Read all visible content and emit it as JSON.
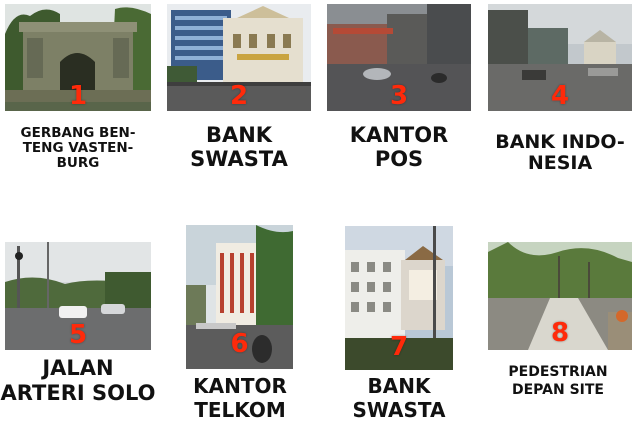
{
  "items": [
    {
      "number": "1",
      "caption": [
        "GERBANG BEN-",
        "TENG VASTEN-",
        "BURG"
      ]
    },
    {
      "number": "2",
      "caption": [
        "BANK",
        "SWASTA"
      ]
    },
    {
      "number": "3",
      "caption": [
        "KANTOR",
        "POS"
      ]
    },
    {
      "number": "4",
      "caption": [
        "BANK INDO-",
        "NESIA"
      ]
    },
    {
      "number": "5",
      "caption": [
        "JALAN",
        "ARTERI SOLO"
      ]
    },
    {
      "number": "6",
      "caption": [
        "KANTOR",
        "TELKOM"
      ]
    },
    {
      "number": "7",
      "caption": [
        "BANK",
        "SWASTA"
      ]
    },
    {
      "number": "8",
      "caption": [
        "PEDESTRIAN",
        "DEPAN SITE"
      ]
    }
  ]
}
